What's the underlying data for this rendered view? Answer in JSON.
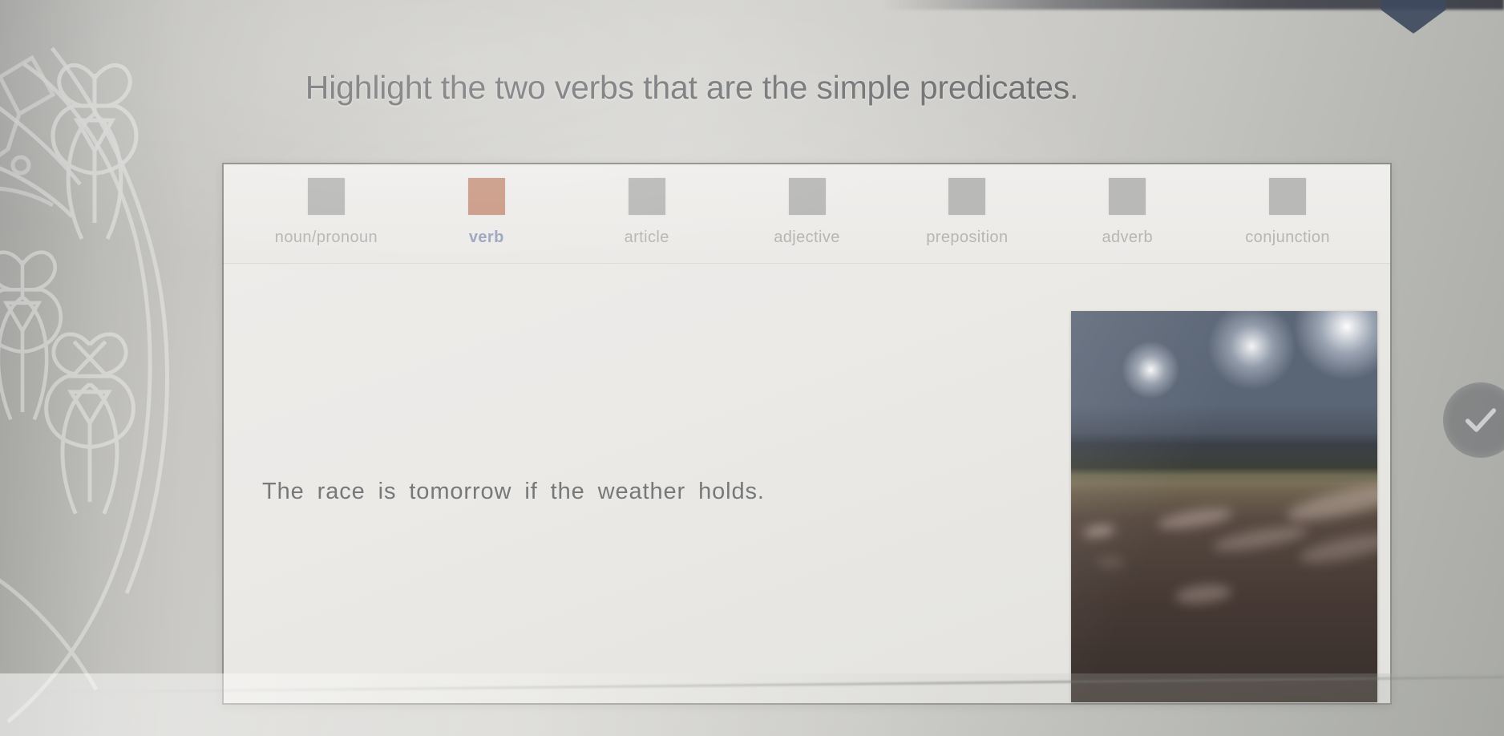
{
  "heading": {
    "text": "Highlight the two verbs that are the simple predicates."
  },
  "legend": {
    "items": [
      {
        "label": "noun/pronoun",
        "color": "#b9b9b7",
        "selected": false
      },
      {
        "label": "verb",
        "color": "#c99a85",
        "selected": true
      },
      {
        "label": "article",
        "color": "#b9b9b7",
        "selected": false
      },
      {
        "label": "adjective",
        "color": "#b9b9b7",
        "selected": false
      },
      {
        "label": "preposition",
        "color": "#b9b9b7",
        "selected": false
      },
      {
        "label": "adverb",
        "color": "#b9b9b7",
        "selected": false
      },
      {
        "label": "conjunction",
        "color": "#b9b9b7",
        "selected": false
      }
    ]
  },
  "exercise": {
    "sentence": "The race is tomorrow if the weather holds.",
    "tokens": [
      "The",
      "race",
      "is",
      "tomorrow",
      "if",
      "the",
      "weather",
      "holds",
      "."
    ]
  },
  "photo": {
    "alt": "Night photo of a wet running track lit by three stadium floodlights"
  },
  "actions": {
    "submit_icon": "check-icon"
  },
  "decor": {
    "watermark_icon": "iris-flower-pattern",
    "corner_icon": "pentagon-nub"
  }
}
